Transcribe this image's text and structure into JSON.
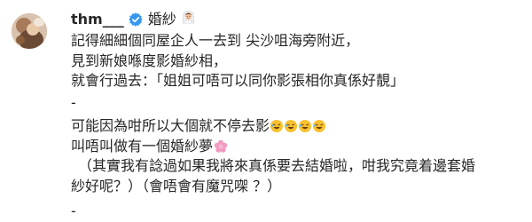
{
  "post": {
    "username": "thm___",
    "caption_first": "婚紗",
    "lines": [
      "記得細細個同屋企人一去到 尖沙咀海旁附近，",
      "見到新娘喺度影婚紗相，",
      "就會行過去：「姐姐可唔可以同你影張相你真係好靚」",
      "-",
      "可能因為咁所以大個就不停去影",
      "叫唔叫做有一個婚紗夢",
      "（其實我有諗過如果我將來真係要去結婚啦，咁我究竟着邊套婚",
      "紗好呢？）（會唔會有魔咒㗎 ？）",
      "-"
    ]
  },
  "colors": {
    "verified_blue": "#3897f0",
    "text": "#262626",
    "laugh_yellow": "#f7c12f",
    "flower_pink": "#f49ac1"
  },
  "icons": {
    "verified": "verified-badge-icon",
    "bride": "bride-emoji-icon",
    "laugh": "rolling-laughing-emoji-icon",
    "flower": "cherry-blossom-emoji-icon"
  }
}
